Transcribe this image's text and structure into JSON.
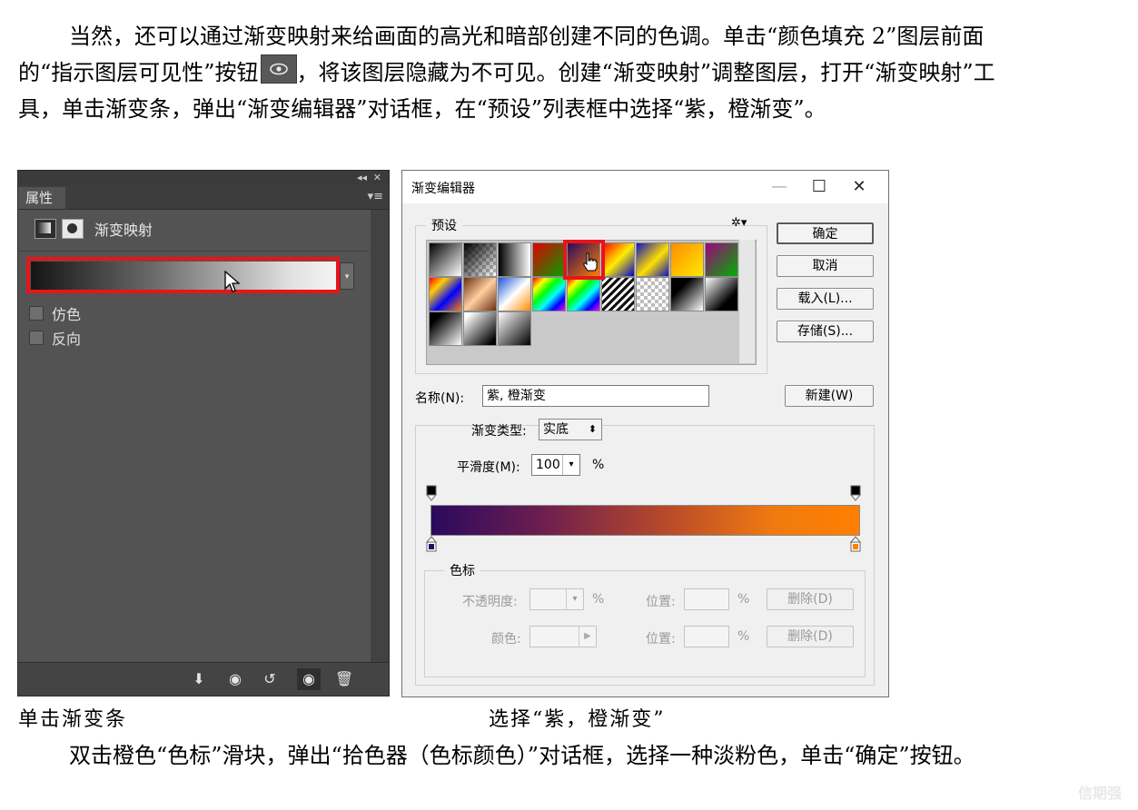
{
  "para1": {
    "part1": "当然，还可以通过渐变映射来给画面的高光和暗部创建不同的色调。单击“颜色填充 2”图层前面的“指示图层可见性”按钮",
    "part2": "，将该图层隐藏为不可见。创建“渐变映射”调整图层，打开“渐变映射”工具，单击渐变条，弹出“渐变编辑器”对话框，在“预设”列表框中选择“紫，橙渐变”。"
  },
  "properties_panel": {
    "tab": "属性",
    "title": "渐变映射",
    "options": [
      "仿色",
      "反向"
    ],
    "collapse_glyph": "◂◂",
    "close_glyph": "✕",
    "menu_glyph": "▾≡"
  },
  "gradient_editor": {
    "title": "渐变编辑器",
    "presets_label": "预设",
    "buttons": {
      "ok": "确定",
      "cancel": "取消",
      "load": "载入(L)...",
      "save": "存储(S)...",
      "new": "新建(W)"
    },
    "name_label": "名称(N):",
    "name_value": "紫, 橙渐变",
    "type_label": "渐变类型:",
    "type_value": "实底",
    "smooth_label": "平滑度(M):",
    "smooth_value": "100",
    "percent": "%",
    "stops_label": "色标",
    "opacity_label": "不透明度:",
    "location_label": "位置:",
    "delete_label": "删除(D)",
    "color_label": "颜色:"
  },
  "captions": {
    "left": "单击渐变条",
    "right": "选择“紫，橙渐变”"
  },
  "para2": "双击橙色“色标”滑块，弹出“拾色器（色标颜色）”对话框，选择一种淡粉色，单击“确定”按钮。",
  "watermark": "信期强",
  "colors": {
    "highlight_red": "#e8141a",
    "ps_panel": "#535353",
    "dialog_bg": "#f0f0f0"
  }
}
